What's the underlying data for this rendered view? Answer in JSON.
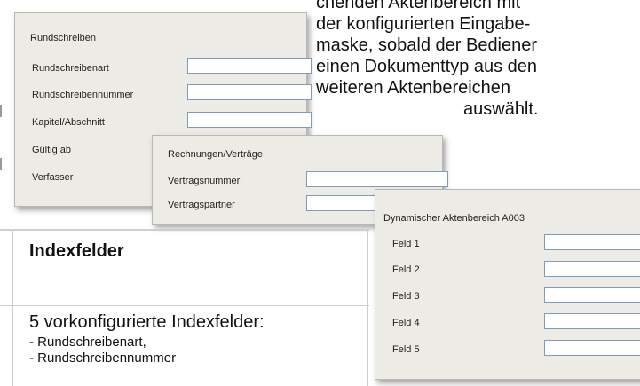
{
  "prose": {
    "lines": [
      "chenden Aktenbereich mit",
      "der konfigurierten Eingabe-",
      "maske, sobald der Bediener",
      "einen Dokumenttyp aus den",
      "weiteren Aktenbereichen",
      "auswählt."
    ],
    "line5_a": "weiteren",
    "line5_b": "Aktenbereichen"
  },
  "panel_rundschreiben": {
    "title": "Rundschreiben",
    "fields": [
      {
        "label": "Rundschreibenart"
      },
      {
        "label": "Rundschreibennummer"
      },
      {
        "label": "Kapitel/Abschnitt"
      },
      {
        "label": "Gültig ab"
      },
      {
        "label": "Verfasser"
      }
    ]
  },
  "panel_rechnungen": {
    "title": "Rechnungen/Verträge",
    "fields": [
      {
        "label": "Vertragsnummer"
      },
      {
        "label": "Vertragspartner"
      }
    ]
  },
  "panel_dynamisch": {
    "title": "Dynamischer Aktenbereich A003",
    "fields": [
      {
        "label": "Feld 1"
      },
      {
        "label": "Feld 2"
      },
      {
        "label": "Feld 3"
      },
      {
        "label": "Feld 4"
      },
      {
        "label": "Feld 5"
      }
    ]
  },
  "table": {
    "header": "Indexfelder",
    "main": "5 vorkonfigurierte Indexfelder:",
    "items": [
      "- Rundschreibenart,",
      "- Rundschreibennummer"
    ]
  }
}
